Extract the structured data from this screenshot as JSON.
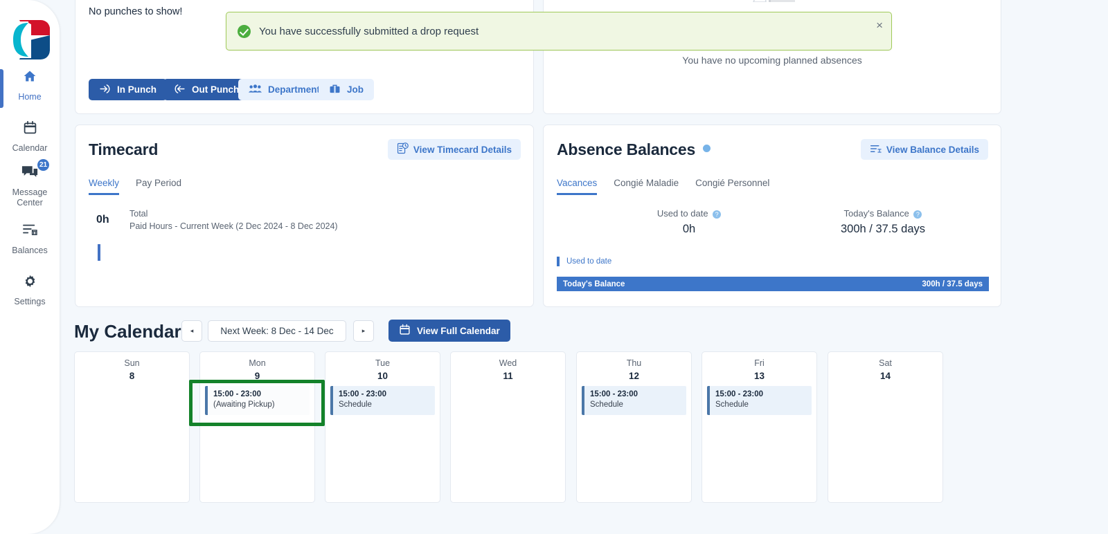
{
  "sidebar": {
    "logo_name": "company-logo",
    "items": [
      {
        "label": "Home",
        "icon": "home-icon",
        "active": true
      },
      {
        "label": "Calendar",
        "icon": "calendar-icon",
        "active": false
      },
      {
        "label": "Message Center",
        "icon": "message-icon",
        "active": false,
        "badge": "21"
      },
      {
        "label": "Balances",
        "icon": "balances-icon",
        "active": false
      },
      {
        "label": "Settings",
        "icon": "gear-icon",
        "active": false
      }
    ]
  },
  "toast": {
    "message": "You have successfully submitted a drop request",
    "close_label": "×",
    "icon": "success-check-icon",
    "bg_color": "#f0f7e3",
    "border_color": "#a0ca59",
    "check_color": "#4cae3f"
  },
  "punches": {
    "empty_text": "No punches to show!",
    "buttons": [
      {
        "label": "In Punch",
        "icon": "arrow-into-door-icon",
        "style": "primary"
      },
      {
        "label": "Out Punch",
        "icon": "arrow-out-door-icon",
        "style": "primary"
      },
      {
        "label": "Department",
        "icon": "people-icon",
        "style": "secondary"
      },
      {
        "label": "Job",
        "icon": "briefcase-icon",
        "style": "secondary"
      }
    ]
  },
  "absences_widget": {
    "empty_text": "You have no upcoming planned absences"
  },
  "timecard": {
    "title": "Timecard",
    "details_button": "View Timecard Details",
    "details_icon": "timecard-details-icon",
    "tabs": [
      {
        "label": "Weekly",
        "active": true
      },
      {
        "label": "Pay Period",
        "active": false
      }
    ],
    "total_hours": "0h",
    "total_label": "Total",
    "total_sub": "Paid Hours - Current Week (2 Dec 2024 - 8 Dec 2024)",
    "bar_color": "#4372c4"
  },
  "balances": {
    "title": "Absence Balances",
    "info_icon": "info-icon",
    "details_button": "View Balance Details",
    "details_icon": "balance-details-icon",
    "tabs": [
      {
        "label": "Vacances",
        "active": true
      },
      {
        "label": "Congié Maladie",
        "active": false
      },
      {
        "label": "Congié Personnel",
        "active": false
      }
    ],
    "used_label": "Used to date",
    "used_value": "0h",
    "today_label": "Today's Balance",
    "today_value": "300h / 37.5 days",
    "legend_label": "Used to date",
    "bar_label": "Today's Balance",
    "bar_value": "300h / 37.5 days",
    "accent_color": "#3d76c9"
  },
  "calendar": {
    "title": "My Calendar",
    "prev_label": "◂",
    "next_label": "▸",
    "range": "Next Week: 8 Dec - 14 Dec",
    "full_button": "View Full Calendar",
    "full_button_icon": "calendar-icon",
    "days": [
      {
        "name": "Sun",
        "num": "8",
        "event": null
      },
      {
        "name": "Mon",
        "num": "9",
        "event": {
          "time": "15:00 - 23:00",
          "sub": "(Awaiting Pickup)",
          "style": "plain",
          "highlighted": true
        }
      },
      {
        "name": "Tue",
        "num": "10",
        "event": {
          "time": "15:00 - 23:00",
          "sub": "Schedule",
          "style": "normal",
          "highlighted": false
        }
      },
      {
        "name": "Wed",
        "num": "11",
        "event": null
      },
      {
        "name": "Thu",
        "num": "12",
        "event": {
          "time": "15:00 - 23:00",
          "sub": "Schedule",
          "style": "normal",
          "highlighted": false
        }
      },
      {
        "name": "Fri",
        "num": "13",
        "event": {
          "time": "15:00 - 23:00",
          "sub": "Schedule",
          "style": "normal",
          "highlighted": false
        }
      },
      {
        "name": "Sat",
        "num": "14",
        "event": null
      }
    ],
    "highlight_color": "#14822a"
  }
}
